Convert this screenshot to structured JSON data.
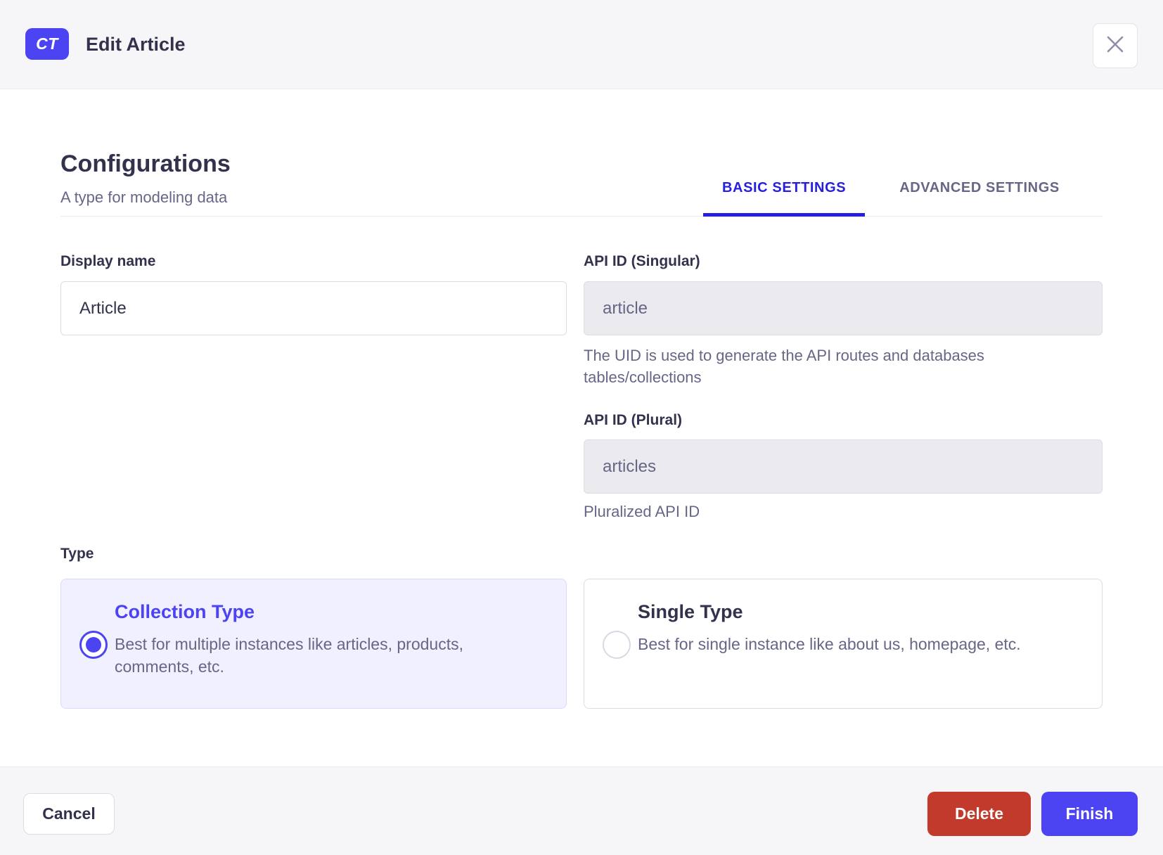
{
  "header": {
    "badge": "CT",
    "title": "Edit Article"
  },
  "configurations": {
    "title": "Configurations",
    "subtitle": "A type for modeling data"
  },
  "tabs": [
    {
      "label": "BASIC SETTINGS",
      "active": true
    },
    {
      "label": "ADVANCED SETTINGS",
      "active": false
    }
  ],
  "form": {
    "display_name": {
      "label": "Display name",
      "value": "Article"
    },
    "api_id_singular": {
      "label": "API ID (Singular)",
      "value": "article",
      "hint": "The UID is used to generate the API routes and databases tables/collections"
    },
    "api_id_plural": {
      "label": "API ID (Plural)",
      "value": "articles",
      "hint": "Pluralized API ID"
    },
    "type": {
      "label": "Type",
      "options": [
        {
          "title": "Collection Type",
          "description": "Best for multiple instances like articles, products, comments, etc.",
          "selected": true
        },
        {
          "title": "Single Type",
          "description": "Best for single instance like about us, homepage, etc.",
          "selected": false
        }
      ]
    }
  },
  "footer": {
    "cancel_label": "Cancel",
    "delete_label": "Delete",
    "finish_label": "Finish"
  },
  "colors": {
    "primary": "#4c43f2",
    "tab_active": "#271fe0",
    "danger": "#c23a2b",
    "header_footer_bg": "#f6f6f9",
    "selected_card_bg": "#f0f0ff",
    "disabled_input_bg": "#eaeaef",
    "text_dark": "#32324d",
    "text_gray": "#666687",
    "border": "#dcdce4"
  }
}
